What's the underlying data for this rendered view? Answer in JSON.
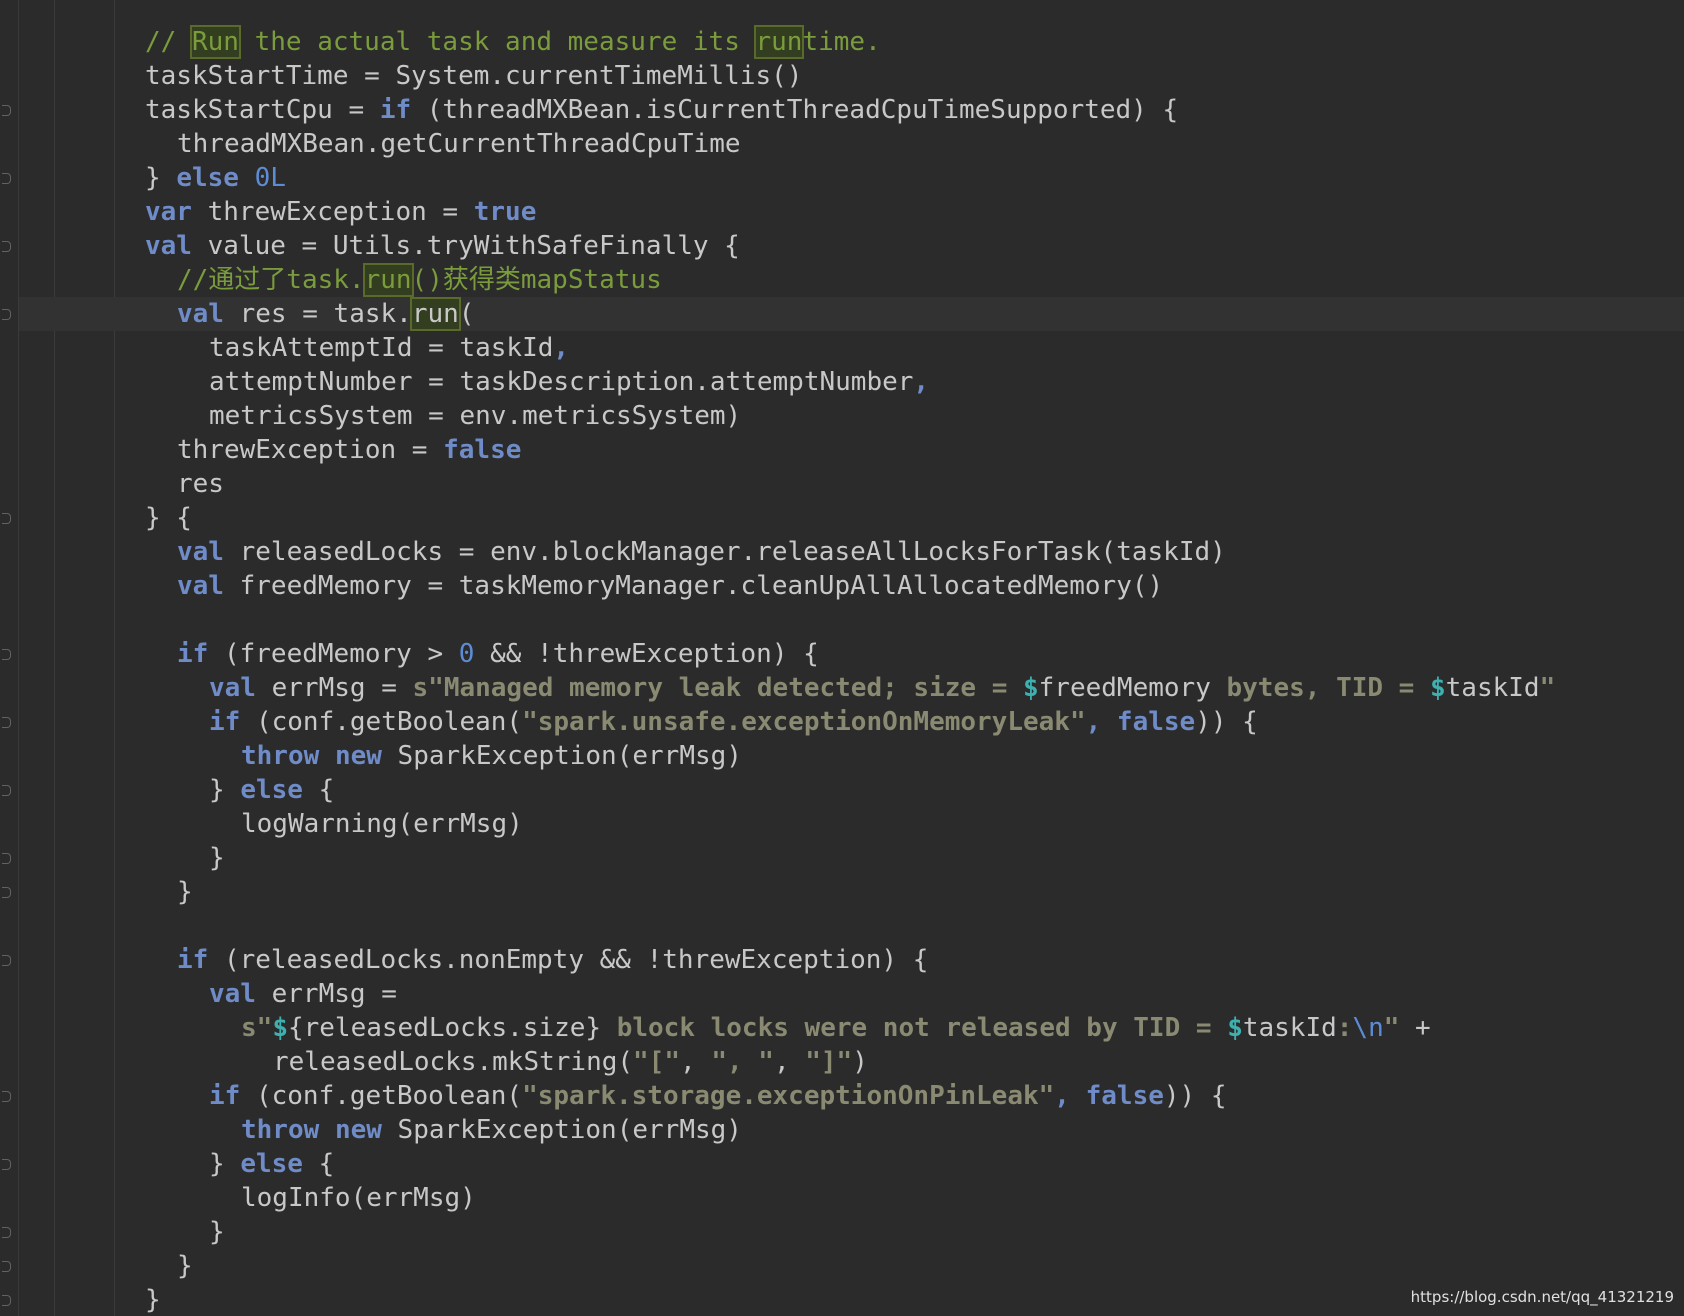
{
  "code": {
    "lines": [
      {
        "indent": 0,
        "tokens": [
          {
            "t": "// ",
            "k": "cm"
          },
          {
            "t": "Run",
            "k": "cm hl"
          },
          {
            "t": " the actual task and measure its ",
            "k": "cm"
          },
          {
            "t": "run",
            "k": "cm hl"
          },
          {
            "t": "time.",
            "k": "cm"
          }
        ]
      },
      {
        "indent": 0,
        "tokens": [
          {
            "t": "taskStartTime = System.currentTimeMillis()",
            "k": ""
          }
        ]
      },
      {
        "indent": 0,
        "tokens": [
          {
            "t": "taskStartCpu = ",
            "k": ""
          },
          {
            "t": "if",
            "k": "kw"
          },
          {
            "t": " (threadMXBean.isCurrentThreadCpuTimeSupported) {",
            "k": ""
          }
        ]
      },
      {
        "indent": 1,
        "tokens": [
          {
            "t": "threadMXBean.getCurrentThreadCpuTime",
            "k": ""
          }
        ]
      },
      {
        "indent": 0,
        "tokens": [
          {
            "t": "} ",
            "k": ""
          },
          {
            "t": "else",
            "k": "kw"
          },
          {
            "t": " ",
            "k": ""
          },
          {
            "t": "0L",
            "k": "num"
          }
        ]
      },
      {
        "indent": 0,
        "tokens": [
          {
            "t": "var",
            "k": "kw"
          },
          {
            "t": " threwException = ",
            "k": ""
          },
          {
            "t": "true",
            "k": "kw"
          }
        ]
      },
      {
        "indent": 0,
        "tokens": [
          {
            "t": "val",
            "k": "kw"
          },
          {
            "t": " value = Utils.tryWithSafeFinally {",
            "k": ""
          }
        ]
      },
      {
        "indent": 1,
        "tokens": [
          {
            "t": "//通过了task.",
            "k": "cm"
          },
          {
            "t": "run",
            "k": "cm hl"
          },
          {
            "t": "()获得类mapStatus",
            "k": "cm"
          }
        ]
      },
      {
        "indent": 1,
        "tokens": [
          {
            "t": "val",
            "k": "kw"
          },
          {
            "t": " res = task.",
            "k": ""
          },
          {
            "t": "run",
            "k": "hl"
          },
          {
            "t": "(",
            "k": ""
          }
        ],
        "current": true
      },
      {
        "indent": 2,
        "tokens": [
          {
            "t": "taskAttemptId = taskId",
            "k": ""
          },
          {
            "t": ",",
            "k": "kw"
          }
        ]
      },
      {
        "indent": 2,
        "tokens": [
          {
            "t": "attemptNumber = taskDescription.attemptNumber",
            "k": ""
          },
          {
            "t": ",",
            "k": "kw"
          }
        ]
      },
      {
        "indent": 2,
        "tokens": [
          {
            "t": "metricsSystem = env.metricsSystem)",
            "k": ""
          }
        ]
      },
      {
        "indent": 1,
        "tokens": [
          {
            "t": "threwException = ",
            "k": ""
          },
          {
            "t": "false",
            "k": "kw"
          }
        ]
      },
      {
        "indent": 1,
        "tokens": [
          {
            "t": "res",
            "k": ""
          }
        ]
      },
      {
        "indent": 0,
        "tokens": [
          {
            "t": "} {",
            "k": ""
          }
        ]
      },
      {
        "indent": 1,
        "tokens": [
          {
            "t": "val",
            "k": "kw"
          },
          {
            "t": " releasedLocks = env.blockManager.releaseAllLocksForTask(taskId)",
            "k": ""
          }
        ]
      },
      {
        "indent": 1,
        "tokens": [
          {
            "t": "val",
            "k": "kw"
          },
          {
            "t": " freedMemory = taskMemoryManager.cleanUpAllAllocatedMemory()",
            "k": ""
          }
        ]
      },
      {
        "indent": 0,
        "tokens": []
      },
      {
        "indent": 1,
        "tokens": [
          {
            "t": "if",
            "k": "kw"
          },
          {
            "t": " (freedMemory > ",
            "k": ""
          },
          {
            "t": "0",
            "k": "num"
          },
          {
            "t": " && !threwException) {",
            "k": ""
          }
        ]
      },
      {
        "indent": 2,
        "tokens": [
          {
            "t": "val",
            "k": "kw"
          },
          {
            "t": " errMsg = ",
            "k": ""
          },
          {
            "t": "s\"Managed memory leak detected; size = ",
            "k": "str"
          },
          {
            "t": "$",
            "k": "dollar"
          },
          {
            "t": "freedMemory",
            "k": ""
          },
          {
            "t": " bytes, TID = ",
            "k": "str"
          },
          {
            "t": "$",
            "k": "dollar"
          },
          {
            "t": "taskId",
            "k": ""
          },
          {
            "t": "\"",
            "k": "str"
          }
        ]
      },
      {
        "indent": 2,
        "tokens": [
          {
            "t": "if",
            "k": "kw"
          },
          {
            "t": " (conf.getBoolean(",
            "k": ""
          },
          {
            "t": "\"spark.unsafe.exceptionOnMemoryLeak\"",
            "k": "str"
          },
          {
            "t": ", ",
            "k": "kw"
          },
          {
            "t": "false",
            "k": "kw"
          },
          {
            "t": ")) {",
            "k": ""
          }
        ]
      },
      {
        "indent": 3,
        "tokens": [
          {
            "t": "throw",
            "k": "kw"
          },
          {
            "t": " ",
            "k": ""
          },
          {
            "t": "new",
            "k": "kw"
          },
          {
            "t": " SparkException(errMsg)",
            "k": ""
          }
        ]
      },
      {
        "indent": 2,
        "tokens": [
          {
            "t": "} ",
            "k": ""
          },
          {
            "t": "else",
            "k": "kw"
          },
          {
            "t": " {",
            "k": ""
          }
        ]
      },
      {
        "indent": 3,
        "tokens": [
          {
            "t": "logWarning(errMsg)",
            "k": ""
          }
        ]
      },
      {
        "indent": 2,
        "tokens": [
          {
            "t": "}",
            "k": ""
          }
        ]
      },
      {
        "indent": 1,
        "tokens": [
          {
            "t": "}",
            "k": ""
          }
        ]
      },
      {
        "indent": 0,
        "tokens": []
      },
      {
        "indent": 1,
        "tokens": [
          {
            "t": "if",
            "k": "kw"
          },
          {
            "t": " (releasedLocks.nonEmpty && !threwException) {",
            "k": ""
          }
        ]
      },
      {
        "indent": 2,
        "tokens": [
          {
            "t": "val",
            "k": "kw"
          },
          {
            "t": " errMsg =",
            "k": ""
          }
        ]
      },
      {
        "indent": 3,
        "tokens": [
          {
            "t": "s\"",
            "k": "str"
          },
          {
            "t": "$",
            "k": "dollar"
          },
          {
            "t": "{releasedLocks.size}",
            "k": ""
          },
          {
            "t": " block locks were not released by TID = ",
            "k": "str"
          },
          {
            "t": "$",
            "k": "dollar"
          },
          {
            "t": "taskId",
            "k": ""
          },
          {
            "t": ":",
            "k": "str"
          },
          {
            "t": "\\n",
            "k": "num"
          },
          {
            "t": "\"",
            "k": "str"
          },
          {
            "t": " +",
            "k": ""
          }
        ]
      },
      {
        "indent": 4,
        "tokens": [
          {
            "t": "releasedLocks.mkString(",
            "k": ""
          },
          {
            "t": "\"[\"",
            "k": "str"
          },
          {
            "t": ", ",
            "k": ""
          },
          {
            "t": "\", \"",
            "k": "str"
          },
          {
            "t": ", ",
            "k": ""
          },
          {
            "t": "\"]\"",
            "k": "str"
          },
          {
            "t": ")",
            "k": ""
          }
        ]
      },
      {
        "indent": 2,
        "tokens": [
          {
            "t": "if",
            "k": "kw"
          },
          {
            "t": " (conf.getBoolean(",
            "k": ""
          },
          {
            "t": "\"spark.storage.exceptionOnPinLeak\"",
            "k": "str"
          },
          {
            "t": ", ",
            "k": "kw"
          },
          {
            "t": "false",
            "k": "kw"
          },
          {
            "t": ")) {",
            "k": ""
          }
        ]
      },
      {
        "indent": 3,
        "tokens": [
          {
            "t": "throw",
            "k": "kw"
          },
          {
            "t": " ",
            "k": ""
          },
          {
            "t": "new",
            "k": "kw"
          },
          {
            "t": " SparkException(errMsg)",
            "k": ""
          }
        ]
      },
      {
        "indent": 2,
        "tokens": [
          {
            "t": "} ",
            "k": ""
          },
          {
            "t": "else",
            "k": "kw"
          },
          {
            "t": " {",
            "k": ""
          }
        ]
      },
      {
        "indent": 3,
        "tokens": [
          {
            "t": "logInfo(errMsg)",
            "k": ""
          }
        ]
      },
      {
        "indent": 2,
        "tokens": [
          {
            "t": "}",
            "k": ""
          }
        ]
      },
      {
        "indent": 1,
        "tokens": [
          {
            "t": "}",
            "k": ""
          }
        ]
      },
      {
        "indent": 0,
        "tokens": [
          {
            "t": "}",
            "k": ""
          }
        ]
      }
    ]
  },
  "watermark": "https://blog.csdn.net/qq_41321219",
  "colors": {
    "background": "#2b2b2b",
    "keyword": "#6f8cc9",
    "comment": "#7a9c3c",
    "string": "#8a8a72",
    "number": "#5d8cd6",
    "interpolation": "#3fb0b0",
    "text": "#c8c8c8"
  }
}
